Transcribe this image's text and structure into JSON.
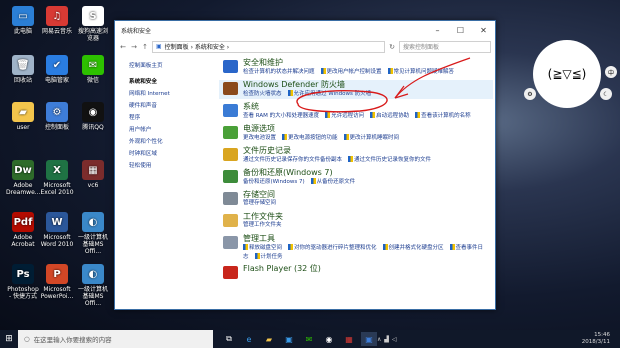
{
  "desktop_icons": [
    {
      "label": "此电脑",
      "color": "#2b7fd6",
      "glyph": "▭"
    },
    {
      "label": "网易云音乐",
      "color": "#d83a34",
      "glyph": "♫"
    },
    {
      "label": "搜狗高速浏览器",
      "color": "#ffffff",
      "glyph": "S"
    },
    {
      "label": "回收站",
      "color": "#9fb3c8",
      "glyph": "🗑"
    },
    {
      "label": "电脑管家",
      "color": "#2a7de1",
      "glyph": "✔"
    },
    {
      "label": "微信",
      "color": "#2dc100",
      "glyph": "✉"
    },
    {
      "label": "user",
      "color": "#f3c54c",
      "glyph": "▰"
    },
    {
      "label": "控制面板",
      "color": "#3e7dd8",
      "glyph": "⚙"
    },
    {
      "label": "腾讯QQ",
      "color": "#111111",
      "glyph": "◉"
    },
    {
      "label": "Adobe Dreamwe...",
      "color": "#2e6b2a",
      "glyph": "Dw"
    },
    {
      "label": "Microsoft Excel 2010",
      "color": "#1f7244",
      "glyph": "X"
    },
    {
      "label": "vc6",
      "color": "#7b2c2c",
      "glyph": "▦"
    },
    {
      "label": "Adobe Acrobat",
      "color": "#b30b00",
      "glyph": "Pdf"
    },
    {
      "label": "Microsoft Word 2010",
      "color": "#2b579a",
      "glyph": "W"
    },
    {
      "label": "一级计算机基础MS Offi...",
      "color": "#3a88c9",
      "glyph": "◐"
    },
    {
      "label": "Photoshop - 快捷方式",
      "color": "#001d34",
      "glyph": "Ps"
    },
    {
      "label": "Microsoft PowerPoi...",
      "color": "#d24726",
      "glyph": "P"
    },
    {
      "label": "一级计算机基础MS Offi...",
      "color": "#3a88c9",
      "glyph": "◐"
    }
  ],
  "window": {
    "title": "系统和安全",
    "address": "控制面板 › 系统和安全 ›",
    "search_placeholder": "搜索控制面板",
    "left_nav": {
      "home": "控制面板主页",
      "current": "系统和安全",
      "items": [
        "网络和 Internet",
        "硬件和声音",
        "程序",
        "用户帐户",
        "外观和个性化",
        "时钟和区域",
        "轻松使用"
      ]
    },
    "categories": [
      {
        "title": "安全和维护",
        "color": "#2a66c9",
        "links": [
          "检查计算机的状态并解决问题",
          "更改用户帐户控制设置",
          "常见计算机问题疑难解答"
        ]
      },
      {
        "title": "Windows Defender 防火墙",
        "color": "#8b4a1c",
        "links": [
          "检查防火墙状态",
          "允许应用通过 Windows 防火墙"
        ]
      },
      {
        "title": "系统",
        "color": "#3a7bd5",
        "links": [
          "查看 RAM 的大小和处理器速度",
          "允许远程访问",
          "启动远程协助",
          "查看该计算机的名称"
        ]
      },
      {
        "title": "电源选项",
        "color": "#4aa038",
        "links": [
          "更改电池设置",
          "更改电源按钮的功能",
          "更改计算机睡眠时间"
        ]
      },
      {
        "title": "文件历史记录",
        "color": "#d9a520",
        "links": [
          "通过文件历史记录保存你的文件备份副本",
          "通过文件历史记录恢复你的文件"
        ]
      },
      {
        "title": "备份和还原(Windows 7)",
        "color": "#3d8c3a",
        "links": [
          "备份和还原(Windows 7)",
          "从备份还原文件"
        ]
      },
      {
        "title": "存储空间",
        "color": "#7f8a96",
        "links": [
          "管理存储空间"
        ]
      },
      {
        "title": "工作文件夹",
        "color": "#e0b24a",
        "links": [
          "管理工作文件夹"
        ]
      },
      {
        "title": "管理工具",
        "color": "#8a96a8",
        "links": [
          "释放磁盘空间",
          "对你的驱动器进行碎片整理和优化",
          "创建并格式化硬盘分区",
          "查看事件日志",
          "计划任务"
        ]
      },
      {
        "title": "Flash Player (32 位)",
        "color": "#c8261c",
        "links": []
      }
    ]
  },
  "taskbar": {
    "search_placeholder": "在这里输入你要搜索的内容",
    "time": "15:46",
    "date": "2018/3/11"
  }
}
